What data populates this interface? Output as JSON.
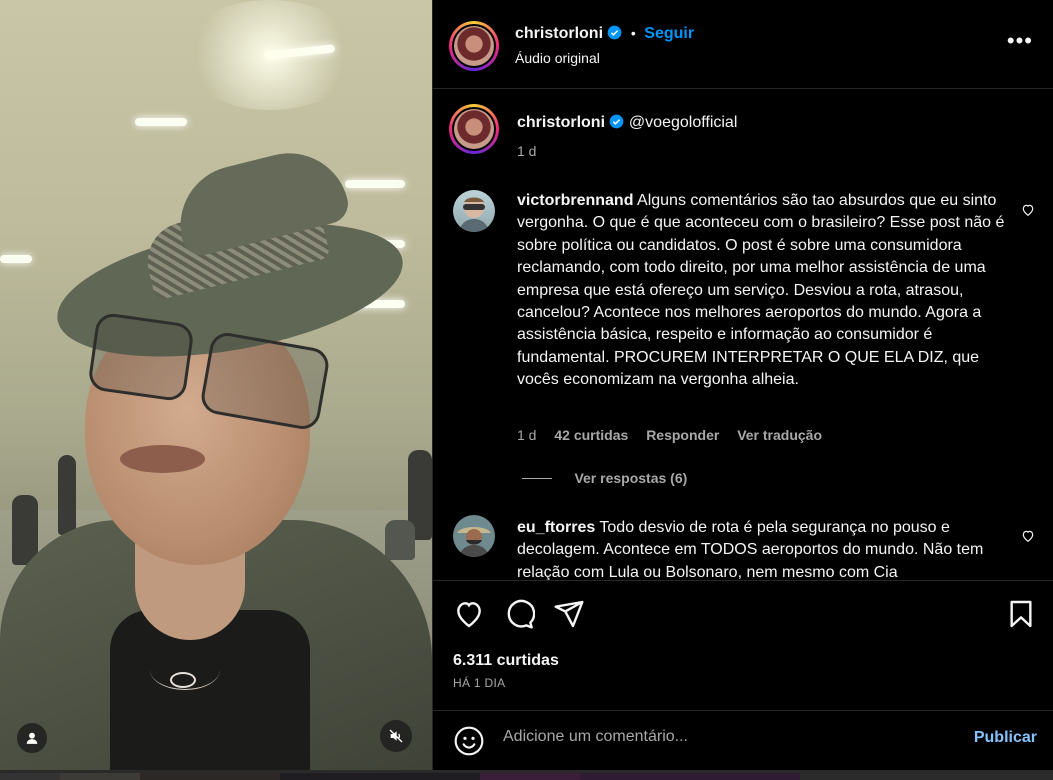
{
  "post": {
    "author": "christorloni",
    "follow_label": "Seguir",
    "separator": "•",
    "audio_label": "Áudio original",
    "more_label": "•••",
    "caption_mention": "@voegolofficial",
    "caption_age": "1 d"
  },
  "comments": [
    {
      "username": "victorbrennand",
      "text": "Alguns comentários são tao absurdos que eu sinto vergonha. O que é que aconteceu com o brasileiro? Esse post não é sobre política ou candidatos. O post é sobre uma consumidora reclamando, com todo direito, por uma melhor assistência de uma empresa que está ofereço um serviço. Desviou a rota, atrasou, cancelou? Acontece nos melhores aeroportos do mundo. Agora a assistência básica, respeito e informação ao consumidor é fundamental. PROCUREM INTERPRETAR O QUE ELA DIZ, que vocês economizam na vergonha alheia.",
      "age": "1 d",
      "likes": "42 curtidas",
      "reply_label": "Responder",
      "translate_label": "Ver tradução",
      "view_replies": "Ver respostas (6)"
    },
    {
      "username": "eu_ftorres",
      "text": "Todo desvio de rota é pela segurança no pouso e decolagem. Acontece em TODOS aeroportos do mundo. Não tem relação com Lula ou Bolsonaro, nem mesmo com Cia"
    }
  ],
  "actions": {
    "likes_count": "6.311 curtidas",
    "date": "HÁ 1 DIA"
  },
  "add_comment": {
    "placeholder": "Adicione um comentário...",
    "publish_label": "Publicar"
  },
  "icons": [
    "verified-icon",
    "more-icon",
    "heart-icon",
    "comment-icon",
    "share-icon",
    "bookmark-icon",
    "emoji-icon",
    "user-tag-icon",
    "mute-icon"
  ],
  "colors": {
    "link_blue": "#0095f6",
    "publish_blue": "#85c2ff",
    "muted_text": "#a8a8a8",
    "divider": "#262626",
    "background": "#000000"
  }
}
